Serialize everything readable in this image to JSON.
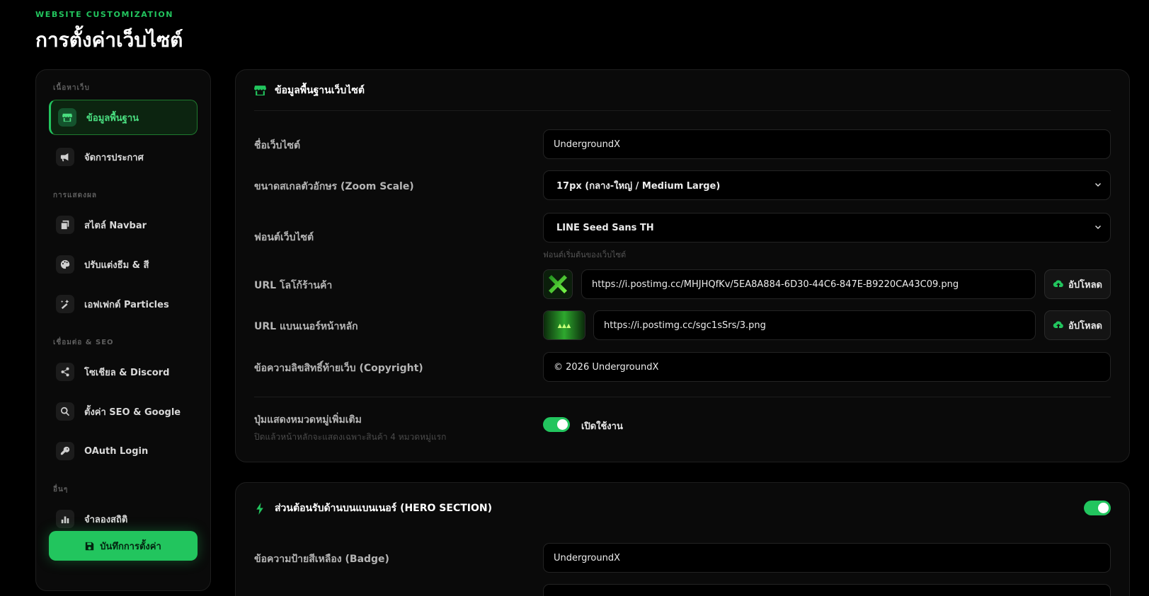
{
  "header": {
    "eyebrow": "WEBSITE CUSTOMIZATION",
    "title": "การตั้งค่าเว็บไซต์"
  },
  "sidebar": {
    "groups": [
      {
        "label": "เนื้อหาเว็บ",
        "items": [
          {
            "label": "ข้อมูลพื้นฐาน",
            "icon": "store-icon",
            "active": true
          },
          {
            "label": "จัดการประกาศ",
            "icon": "megaphone-icon"
          }
        ]
      },
      {
        "label": "การแสดงผล",
        "items": [
          {
            "label": "สไตล์ Navbar",
            "icon": "layers-icon"
          },
          {
            "label": "ปรับแต่งธีม & สี",
            "icon": "palette-icon"
          },
          {
            "label": "เอฟเฟกต์ Particles",
            "icon": "magic-wand-icon"
          }
        ]
      },
      {
        "label": "เชื่อมต่อ & SEO",
        "items": [
          {
            "label": "โซเชียล & Discord",
            "icon": "share-icon"
          },
          {
            "label": "ตั้งค่า SEO & Google",
            "icon": "search-icon"
          },
          {
            "label": "OAuth Login",
            "icon": "key-icon"
          }
        ]
      },
      {
        "label": "อื่นๆ",
        "items": [
          {
            "label": "จำลองสถิติ",
            "icon": "bar-chart-icon"
          }
        ]
      }
    ],
    "save_label": "บันทึกการตั้งค่า"
  },
  "basic_card": {
    "title": "ข้อมูลพื้นฐานเว็บไซต์",
    "site_name": {
      "label": "ชื่อเว็บไซต์",
      "value": "UndergroundX"
    },
    "zoom": {
      "label": "ขนาดสเกลตัวอักษร (Zoom Scale)",
      "value": "17px (กลาง-ใหญ่ / Medium Large)"
    },
    "font": {
      "label": "ฟอนต์เว็บไซต์",
      "value": "LINE Seed Sans TH",
      "hint": "ฟอนต์เริ่มต้นของเว็บไซต์"
    },
    "logo": {
      "label": "URL โลโก้ร้านค้า",
      "value": "https://i.postimg.cc/MHJHQfKv/5EA8A884-6D30-44C6-847E-B9220CA43C09.png",
      "upload_label": "อัปโหลด"
    },
    "banner": {
      "label": "URL แบนเนอร์หน้าหลัก",
      "value": "https://i.postimg.cc/sgc1sSrs/3.png",
      "upload_label": "อัปโหลด"
    },
    "copyright": {
      "label": "ข้อความลิขสิทธิ์ท้ายเว็บ (Copyright)",
      "value": "© 2026 UndergroundX"
    },
    "more_categories": {
      "label": "ปุ่มแสดงหมวดหมู่เพิ่มเติม",
      "sublabel": "ปิดแล้วหน้าหลักจะแสดงเฉพาะสินค้า 4 หมวดหมู่แรก",
      "toggle_label": "เปิดใช้งาน",
      "enabled": true
    }
  },
  "hero_card": {
    "title": "ส่วนต้อนรับด้านบนแบนเนอร์ (HERO SECTION)",
    "enabled": true,
    "badge": {
      "label": "ข้อความป้ายสีเหลือง (Badge)",
      "value": "UndergroundX"
    }
  },
  "colors": {
    "accent": "#22c55e",
    "background": "#000000",
    "card": "#0a0a0a"
  }
}
